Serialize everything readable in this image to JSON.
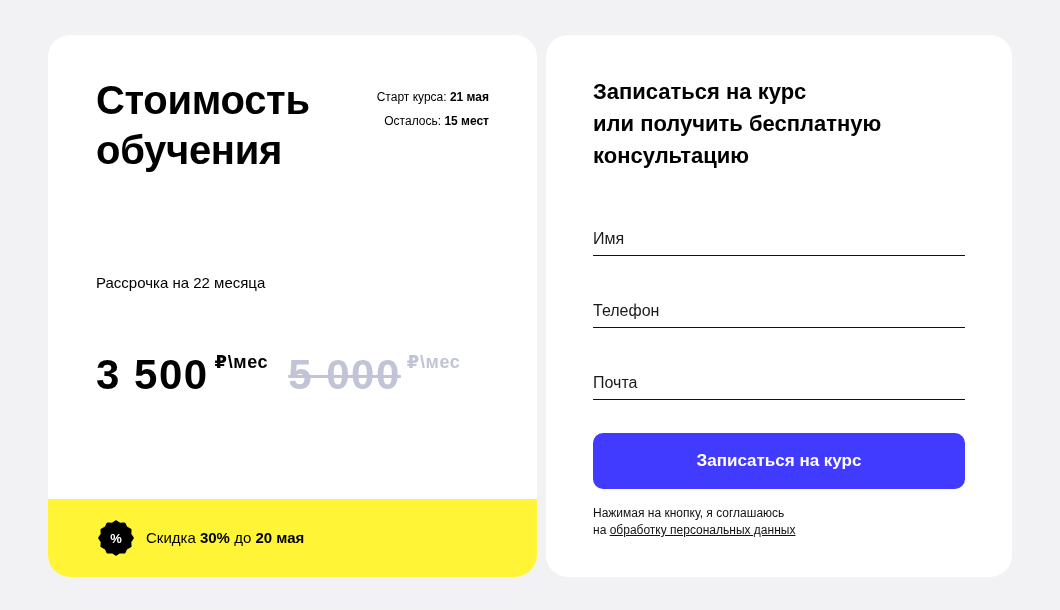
{
  "pricing": {
    "title": "Стоимость обучения",
    "meta": [
      "Старт курса: **21 мая**",
      "Осталось: **15 мест**"
    ],
    "installment": "Рассрочка на 22 месяца",
    "price": {
      "amount": "3 500",
      "unit": "₽\\мес"
    },
    "old_price": {
      "amount": "5 000",
      "unit": "₽\\мес"
    },
    "discount": {
      "badge": "%",
      "text": "Скидка **30%** до **20 мая**"
    }
  },
  "signup": {
    "title_lines": [
      "Записаться на курс",
      "или получить бесплатную",
      "консультацию"
    ],
    "fields": [
      {
        "placeholder": "Имя"
      },
      {
        "placeholder": "Телефон"
      },
      {
        "placeholder": "Почта"
      }
    ],
    "submit": "Записаться на курс",
    "consent": {
      "text": "Нажимая на кнопку, я соглашаюсь",
      "link_lead": "на",
      "link": "обработку персональных данных"
    }
  }
}
